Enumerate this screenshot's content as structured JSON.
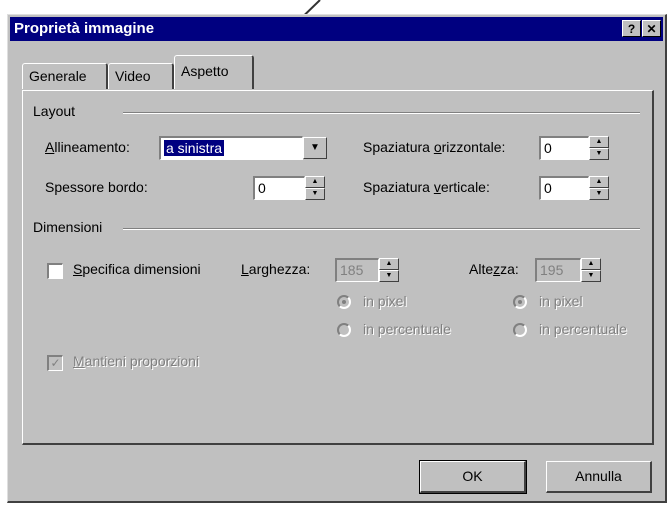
{
  "window": {
    "title": "Proprietà immagine",
    "help_label": "?",
    "close_label": "✕"
  },
  "tabs": [
    {
      "label": "Generale",
      "active": false
    },
    {
      "label": "Video",
      "active": false
    },
    {
      "label": "Aspetto",
      "active": true
    }
  ],
  "layout_group": {
    "label": "Layout",
    "alignment_label": "Allineamento:",
    "alignment_value": "a sinistra",
    "border_label": "Spessore bordo:",
    "border_value": "0",
    "hspacing_label": "Spaziatura orizzontale:",
    "hspacing_value": "0",
    "vspacing_label": "Spaziatura verticale:",
    "vspacing_value": "0"
  },
  "dimensions_group": {
    "label": "Dimensioni",
    "specify_label": "Specifica dimensioni",
    "specify_checked": false,
    "width_label": "Larghezza:",
    "width_value": "185",
    "height_label": "Altezza:",
    "height_value": "195",
    "pixel_label": "in pixel",
    "percent_label": "in percentuale",
    "keep_ratio_label": "Mantieni proporzioni",
    "keep_ratio_checked": true
  },
  "buttons": {
    "ok_label": "OK",
    "cancel_label": "Annulla"
  },
  "colors": {
    "titlebar": "#000080",
    "face": "#c0c0c0",
    "selection": "#000080"
  }
}
